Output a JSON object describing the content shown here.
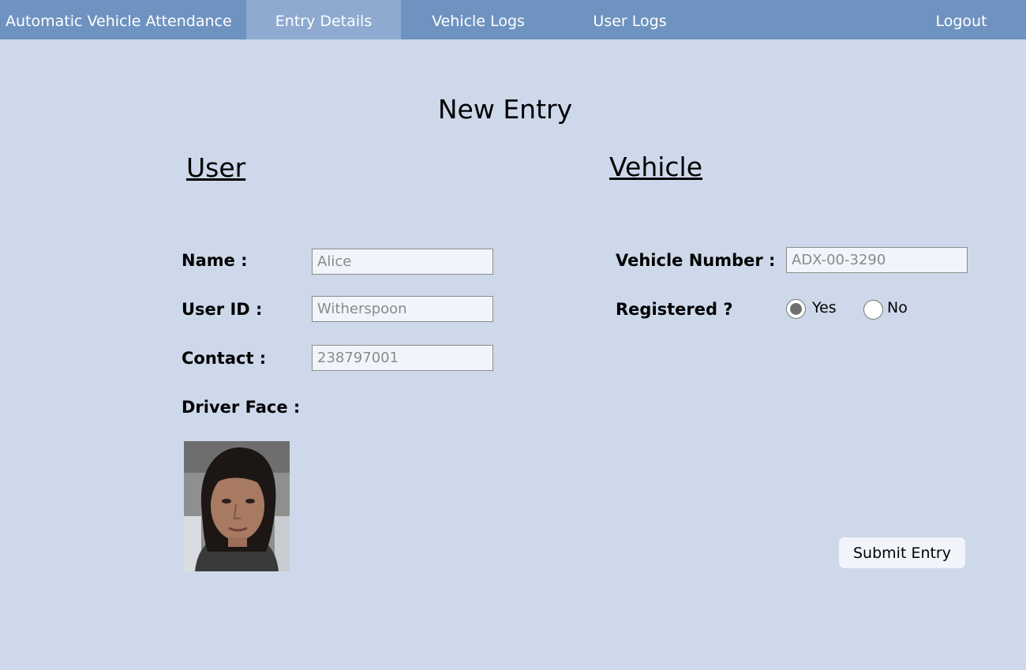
{
  "nav": {
    "brand": "Automatic Vehicle Attendance",
    "entry_details": "Entry Details",
    "vehicle_logs": "Vehicle Logs",
    "user_logs": "User Logs",
    "logout": "Logout"
  },
  "page": {
    "title": "New Entry"
  },
  "user": {
    "heading": "User",
    "name_label": "Name :",
    "name_value": "Alice",
    "user_id_label": "User ID :",
    "user_id_value": "Witherspoon",
    "contact_label": "Contact :",
    "contact_value": "238797001",
    "face_label": "Driver Face :"
  },
  "vehicle": {
    "heading": "Vehicle",
    "number_label": "Vehicle Number :",
    "number_value": "ADX-00-3290",
    "registered_label": "Registered ?",
    "yes_label": "Yes",
    "no_label": "No",
    "registered_selected": "Yes"
  },
  "actions": {
    "submit_label": "Submit Entry"
  },
  "colors": {
    "navbar": "#6f93c0",
    "nav_active": "#8eaad0",
    "background": "#cdd9ea",
    "field_bg": "#f1f5fb"
  }
}
